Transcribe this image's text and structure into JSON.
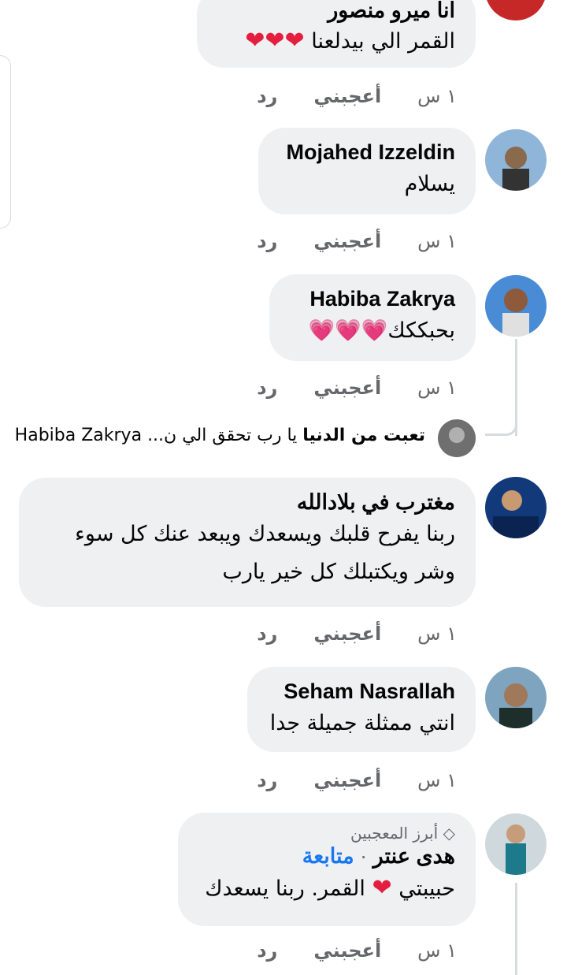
{
  "comments": [
    {
      "author": "انا ميرو منصور",
      "text": "القمر الي بيدلعنا",
      "hearts": "❤❤❤",
      "time": "١ س",
      "like": "أعجبني",
      "reply": "رد"
    },
    {
      "author": "Mojahed Izzeldin",
      "text": "يسلام",
      "time": "١ س",
      "like": "أعجبني",
      "reply": "رد"
    },
    {
      "author": "Habiba Zakrya",
      "text": "بحبككك",
      "hearts": "💗💗💗",
      "time": "١ س",
      "like": "أعجبني",
      "reply": "رد"
    },
    {
      "author": "مغترب في بلادالله",
      "text1": "ربنا يفرح قلبك ويسعدك ويبعد عنك كل سوء",
      "text2": "وشر ويكتبلك كل خير يارب",
      "time": "١ س",
      "like": "أعجبني",
      "reply": "رد"
    },
    {
      "author": "Seham Nasrallah",
      "text": "انتي ممثلة جميلة جدا",
      "time": "١ س",
      "like": "أعجبني",
      "reply": "رد"
    },
    {
      "badge": "أبرز المعجبين",
      "author": "هدى عنتر",
      "separator": "·",
      "follow": "متابعة",
      "text_a": "حبيبتي",
      "text_b": "القمر. ربنا يسعدك",
      "time": "١ س",
      "like": "أعجبني",
      "reply": "رد"
    }
  ],
  "reply_preview": {
    "author": "تعبت من الدنيا",
    "text": "يا رب تحقق الي ن...",
    "mention": "Habiba Zakrya"
  },
  "colors": {
    "bubble": "#eff0f2",
    "meta": "#65676b",
    "heart": "#e41e3f",
    "link": "#1877f2"
  }
}
